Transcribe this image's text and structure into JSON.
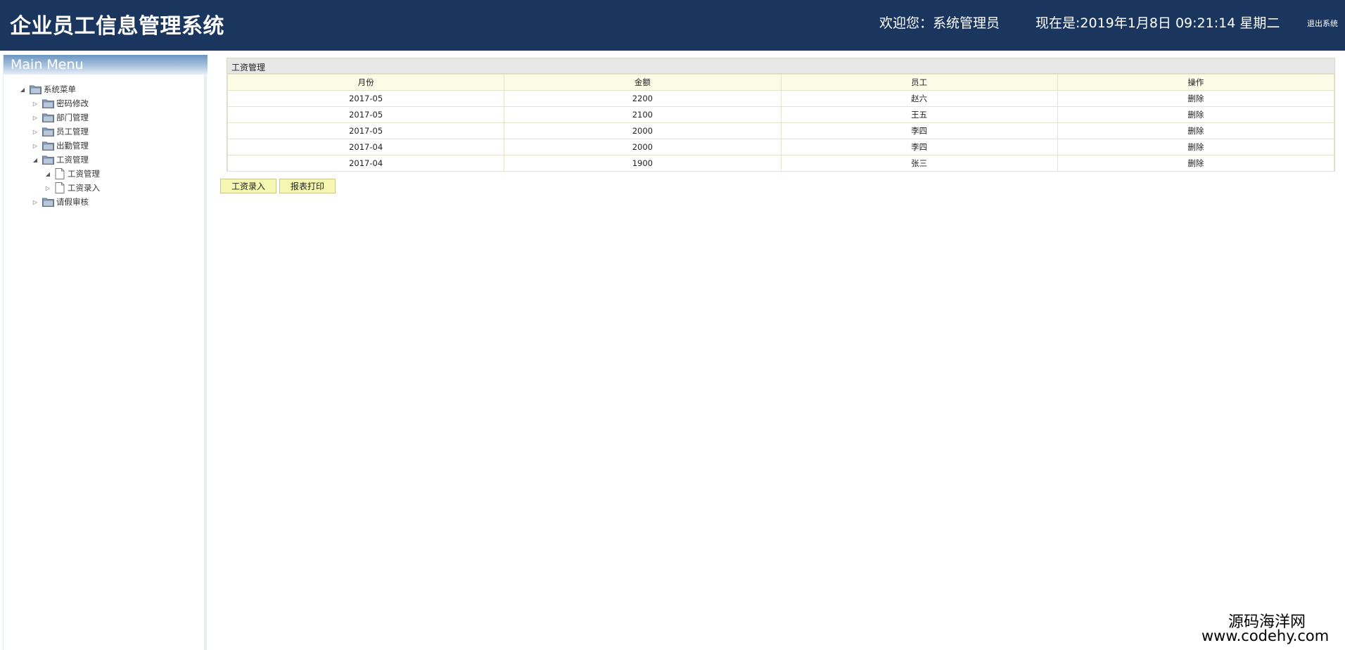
{
  "header": {
    "title": "企业员工信息管理系统",
    "welcome": "欢迎您：系统管理员",
    "datetime": "现在是:2019年1月8日 09:21:14 星期二",
    "logout": "退出系统"
  },
  "sidebar": {
    "heading": "Main Menu",
    "tree": {
      "root": "系统菜单",
      "items": [
        {
          "label": "密码修改",
          "expanded": false
        },
        {
          "label": "部门管理",
          "expanded": false
        },
        {
          "label": "员工管理",
          "expanded": false
        },
        {
          "label": "出勤管理",
          "expanded": false
        },
        {
          "label": "工资管理",
          "expanded": true,
          "children": [
            {
              "label": "工资管理",
              "expanded": true
            },
            {
              "label": "工资录入",
              "expanded": false
            }
          ]
        },
        {
          "label": "请假审核",
          "expanded": false
        }
      ]
    },
    "toggle_expanded": "◢",
    "toggle_collapsed": "▷"
  },
  "main": {
    "panel_title": "工资管理",
    "columns": [
      "月份",
      "金额",
      "员工",
      "操作"
    ],
    "rows": [
      [
        "2017-05",
        "2200",
        "赵六",
        "删除"
      ],
      [
        "2017-05",
        "2100",
        "王五",
        "删除"
      ],
      [
        "2017-05",
        "2000",
        "李四",
        "删除"
      ],
      [
        "2017-04",
        "2000",
        "李四",
        "删除"
      ],
      [
        "2017-04",
        "1900",
        "张三",
        "删除"
      ]
    ],
    "buttons": {
      "add": "工资录入",
      "print": "报表打印"
    }
  },
  "watermark": {
    "line1": "源码海洋网",
    "line2": "www.codehy.com"
  },
  "colors": {
    "header_bg": "#1b365e",
    "table_header_bg": "#fbfbe6",
    "button_bg": "#f6f7b0"
  }
}
